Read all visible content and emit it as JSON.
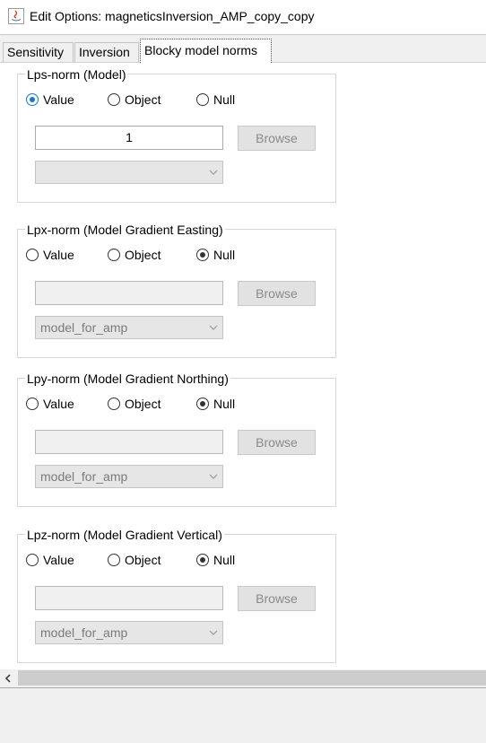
{
  "window": {
    "title": "Edit Options: magneticsInversion_AMP_copy_copy"
  },
  "tabs": [
    {
      "label": "Sensitivity",
      "active": false
    },
    {
      "label": "Inversion",
      "active": false
    },
    {
      "label": "Blocky model norms",
      "active": true
    }
  ],
  "radio_labels": {
    "value": "Value",
    "object": "Object",
    "null": "Null"
  },
  "browse_label": "Browse",
  "groups": [
    {
      "legend": "Lps-norm (Model)",
      "selected": "value",
      "text_value": "1",
      "combo_value": ""
    },
    {
      "legend": "Lpx-norm  (Model Gradient Easting)",
      "selected": "null",
      "text_value": "",
      "combo_value": "model_for_amp"
    },
    {
      "legend": "Lpy-norm  (Model Gradient Northing)",
      "selected": "null",
      "text_value": "",
      "combo_value": "model_for_amp"
    },
    {
      "legend": "Lpz-norm  (Model Gradient Vertical)",
      "selected": "null",
      "text_value": "",
      "combo_value": "model_for_amp"
    }
  ],
  "colors": {
    "accent": "#1677d2",
    "disabled_text": "#8a8a8a"
  }
}
